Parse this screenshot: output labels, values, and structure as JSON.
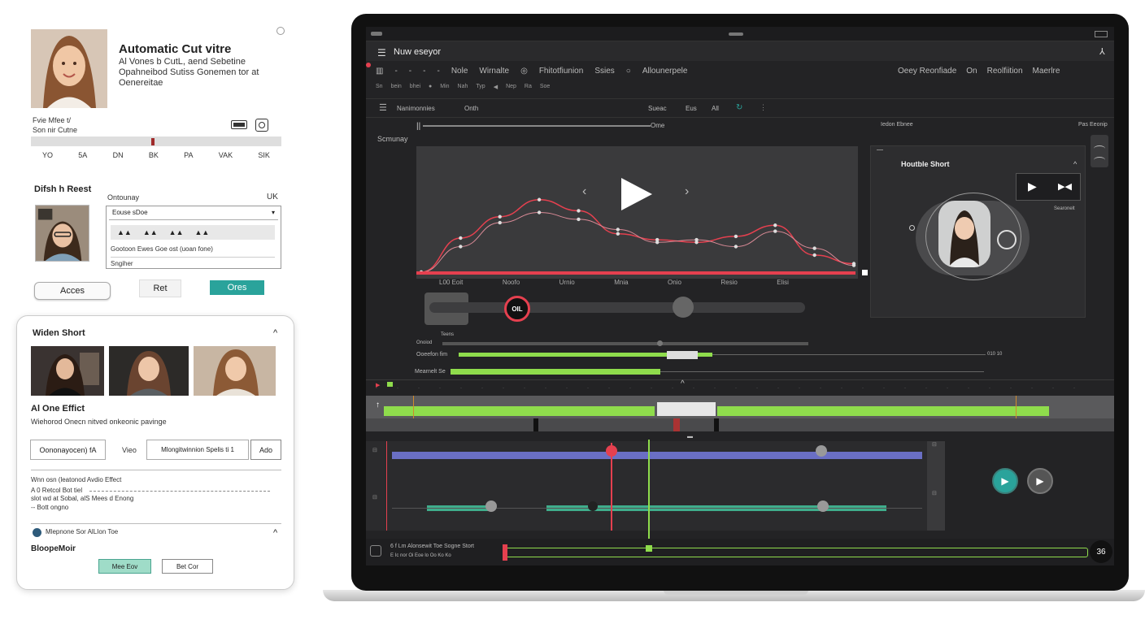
{
  "left_top": {
    "title": "Automatic Cut vitre",
    "desc_line1": "Al Vones b CutL, aend Sebetine",
    "desc_line2": "Opahneibod Sutiss Gonemen tor at",
    "desc_line3": "Oenereitae",
    "info_line1": "Fvie Mfee t/",
    "info_line2": "Son nir Cutne",
    "timeline_labels": [
      "YO",
      "5A",
      "DN",
      "BK",
      "PA",
      "VAK",
      "SIK"
    ]
  },
  "left_mid": {
    "section_title": "Difsh h Reest",
    "category_label": "Ontounay",
    "country": "UK",
    "dropdown_value": "Eouse sDoe",
    "row_text": "Gootoon Ewes Goe ost (uoan fone)",
    "field_label": "Sngiher",
    "buttons": {
      "accept": "Acces",
      "reset": "Ret",
      "apply": "Ores"
    }
  },
  "left_card": {
    "title": "Widen Short",
    "effect_title": "Al One Effict",
    "effect_desc": "Wiehorod Onecn nitved onkeonic pavinge",
    "control1": "Oononayocen) fA",
    "control_label": "Vieo",
    "control2": "Mlongitwinnion Spelis ti 1",
    "apply_label": "Ado",
    "audio_title": "Wnn osn (leatonod Avdio Effect",
    "audio_line1": "A 0 Retcol Bot tiel",
    "audio_line2": "slot wd at Sobal, alS Mees d Enong",
    "audio_line3": "-- Bott ongno",
    "section2": "Mlepnone Sor AlLIon Toe",
    "section3_title": "BloopeMoir",
    "btn_primary": "Mee Eov",
    "btn_secondary": "Bet Cor"
  },
  "editor": {
    "window_title": "Nuw eseyor",
    "menu": [
      "Nole",
      "Wirnalte",
      "Fhitotfiunion",
      "Ssies",
      "Allounerpele"
    ],
    "menu_right": [
      "Oeey Reonfiade",
      "On",
      "Reolfiition",
      "Maerlre"
    ],
    "tool_labels": [
      "Sn",
      "bein",
      "bhei",
      "Min",
      "Nah",
      "Typ",
      "Nep",
      "Ra",
      "Soe"
    ],
    "panel_header": [
      "Nanimonnies",
      "Onth",
      "Sueac",
      "Eus",
      "All"
    ],
    "track_label_top": "Ome",
    "track_label_right": "Iedon Ebnee",
    "track_label_far": "Pas Eeonip",
    "sidebar_label": "Scmunay",
    "chart_labels": [
      "L00 Eoit",
      "Noofo",
      "Urnio",
      "Mnia",
      "Onio",
      "Resio",
      "Elisi"
    ],
    "preview_title": "Houtble Short",
    "preview_caption": "Searonelt",
    "knob_label": "OIL",
    "slider_labels": [
      "Onoiod",
      "Ooeefon fim",
      "Mearnelt Se"
    ],
    "slider_small": "Teens",
    "slider_value": "010 10",
    "timeline_text1": "6 f Lm Alonsewit Toe Sogne Stort",
    "timeline_text2": "E  Ic  nor Oi Eoe lo Oo Ko Ko",
    "timecode": "36",
    "colors": {
      "accent_green": "#8fdc4c",
      "accent_red": "#e5404f",
      "accent_teal": "#2aa39b",
      "track_blue": "#6a6fc4"
    }
  },
  "chart_data": {
    "type": "line",
    "categories": [
      "L00 Eoit",
      "Noofo",
      "Urnio",
      "Mnia",
      "Onio",
      "Resio",
      "Elisi"
    ],
    "series": [
      {
        "values": [
          0,
          40,
          65,
          85,
          72,
          45,
          38,
          35,
          42,
          55,
          20,
          10
        ]
      },
      {
        "values": [
          0,
          30,
          58,
          70,
          62,
          50,
          35,
          38,
          30,
          48,
          28,
          8
        ]
      }
    ]
  }
}
